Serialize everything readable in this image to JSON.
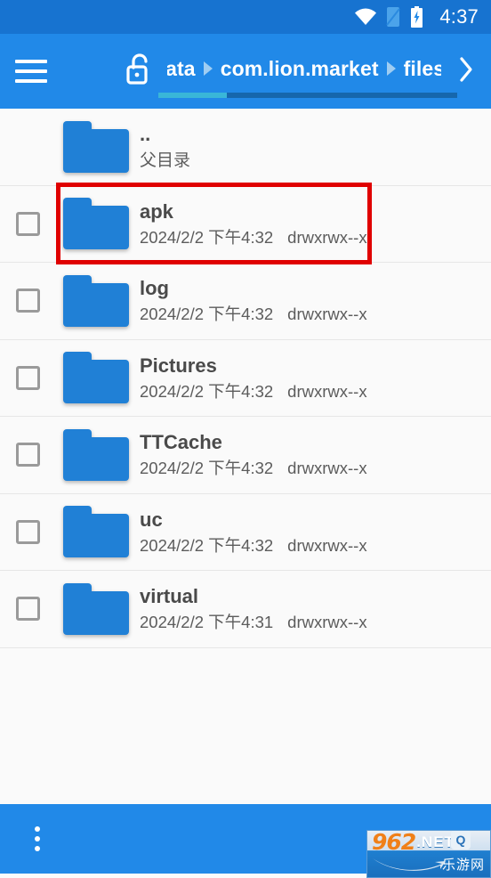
{
  "status_bar": {
    "time": "4:37",
    "icons": [
      "wifi-icon",
      "sim-card-icon",
      "battery-charging-icon"
    ],
    "background_color": "#1773d0"
  },
  "toolbar": {
    "background_color": "#2189e8",
    "menu_icon": "hamburger-menu-icon",
    "lock_icon": "unlocked-padlock-icon",
    "forward_icon": "chevron-right-icon",
    "breadcrumb": [
      {
        "label": "data"
      },
      {
        "label": "com.lion.market"
      },
      {
        "label": "files"
      }
    ],
    "separator_icon": "triangle-right-icon",
    "scrollbar": {
      "thumb_percent": 23
    }
  },
  "file_list": {
    "parent_row": {
      "name": "..",
      "subtitle": "父目录",
      "icon": "folder-icon"
    },
    "rows": [
      {
        "name": "apk",
        "date": "2024/2/2 下午4:32",
        "permissions": "drwxrwx--x",
        "icon": "folder-icon",
        "checked": false,
        "highlighted": true
      },
      {
        "name": "log",
        "date": "2024/2/2 下午4:32",
        "permissions": "drwxrwx--x",
        "icon": "folder-icon",
        "checked": false,
        "highlighted": false
      },
      {
        "name": "Pictures",
        "date": "2024/2/2 下午4:32",
        "permissions": "drwxrwx--x",
        "icon": "folder-icon",
        "checked": false,
        "highlighted": false
      },
      {
        "name": "TTCache",
        "date": "2024/2/2 下午4:32",
        "permissions": "drwxrwx--x",
        "icon": "folder-icon",
        "checked": false,
        "highlighted": false
      },
      {
        "name": "uc",
        "date": "2024/2/2 下午4:32",
        "permissions": "drwxrwx--x",
        "icon": "folder-icon",
        "checked": false,
        "highlighted": false
      },
      {
        "name": "virtual",
        "date": "2024/2/2 下午4:31",
        "permissions": "drwxrwx--x",
        "icon": "folder-icon",
        "checked": false,
        "highlighted": false
      }
    ]
  },
  "annotation": {
    "highlight_color": "#e00000"
  },
  "bottom_bar": {
    "background_color": "#2189e8",
    "overflow_icon": "more-vertical-icon",
    "watermark": {
      "number": "962",
      "domain": ".NET",
      "chinese": "乐游网",
      "badge": "Q"
    }
  }
}
